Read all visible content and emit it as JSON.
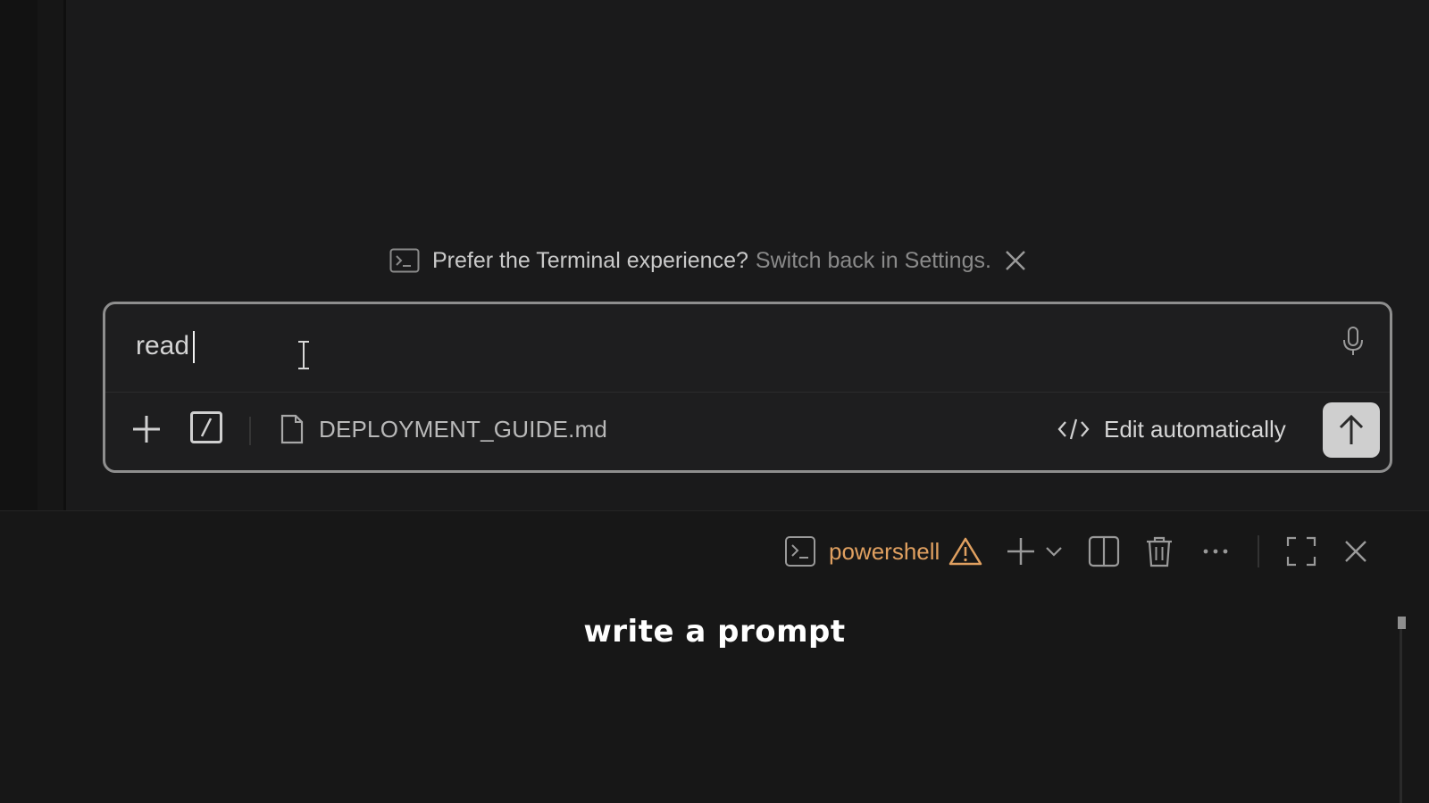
{
  "notice": {
    "text": "Prefer the Terminal experience?",
    "link": "Switch back in Settings."
  },
  "composer": {
    "input_value": "read",
    "attachment": "DEPLOYMENT_GUIDE.md",
    "edit_mode": "Edit automatically"
  },
  "terminal": {
    "tab_label": "powershell"
  },
  "subtitle": "write a prompt",
  "colors": {
    "background": "#191919",
    "composer_border": "#8e8e8e",
    "terminal_tab": "#e0a060",
    "send_button": "#cfcfcf"
  },
  "icons": {
    "notice": "terminal-icon",
    "notice_close": "close-icon",
    "mic": "microphone-icon",
    "add": "plus-icon",
    "slash": "slash-command-icon",
    "attachment": "file-icon",
    "edit_mode": "code-icon",
    "send": "arrow-up-icon",
    "terminal_tab": "terminal-icon",
    "warning": "warning-icon",
    "new_terminal": "plus-icon",
    "terminal_dropdown": "chevron-down-icon",
    "split": "split-icon",
    "trash": "trash-icon",
    "more": "ellipsis-icon",
    "maximize": "maximize-icon",
    "close_panel": "close-icon"
  }
}
